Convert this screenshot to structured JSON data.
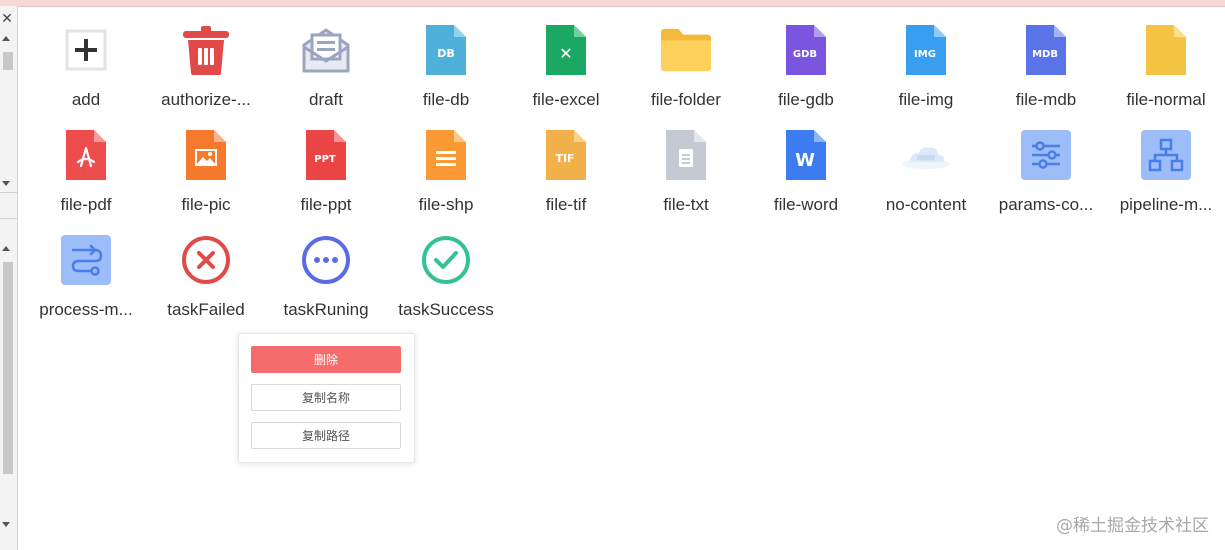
{
  "icons": [
    {
      "label": "add",
      "icon": "add-icon"
    },
    {
      "label": "authorize-...",
      "icon": "trash-icon"
    },
    {
      "label": "draft",
      "icon": "draft-envelope-icon"
    },
    {
      "label": "file-db",
      "icon": "file-db-icon",
      "badge": "DB",
      "color": "#4fb1d9"
    },
    {
      "label": "file-excel",
      "icon": "file-excel-icon",
      "badge": "✕",
      "color": "#1ba862"
    },
    {
      "label": "file-folder",
      "icon": "folder-icon",
      "color": "#fcca4a"
    },
    {
      "label": "file-gdb",
      "icon": "file-gdb-icon",
      "badge": "GDB",
      "color": "#7a55e0"
    },
    {
      "label": "file-img",
      "icon": "file-img-icon",
      "badge": "IMG",
      "color": "#3a9ef0"
    },
    {
      "label": "file-mdb",
      "icon": "file-mdb-icon",
      "badge": "MDB",
      "color": "#5a74e8"
    },
    {
      "label": "file-normal",
      "icon": "file-normal-icon",
      "color": "#f6c443"
    },
    {
      "label": "file-pdf",
      "icon": "file-pdf-icon",
      "color": "#ee4d4d"
    },
    {
      "label": "file-pic",
      "icon": "file-pic-icon",
      "color": "#f57a2e"
    },
    {
      "label": "file-ppt",
      "icon": "file-ppt-icon",
      "badge": "PPT",
      "color": "#ec4546"
    },
    {
      "label": "file-shp",
      "icon": "file-shp-icon",
      "color": "#fb9a35"
    },
    {
      "label": "file-tif",
      "icon": "file-tif-icon",
      "badge": "TIF",
      "color": "#f2b04a"
    },
    {
      "label": "file-txt",
      "icon": "file-txt-icon",
      "color": "#c4c9d3"
    },
    {
      "label": "file-word",
      "icon": "file-word-icon",
      "badge": "W",
      "color": "#3d7cf0"
    },
    {
      "label": "no-content",
      "icon": "no-content-icon"
    },
    {
      "label": "params-co...",
      "icon": "params-sliders-icon",
      "color": "#9dbdf8"
    },
    {
      "label": "pipeline-m...",
      "icon": "pipeline-tree-icon",
      "color": "#9dbdf8"
    },
    {
      "label": "process-m...",
      "icon": "process-flow-icon",
      "color": "#9dbdf8"
    },
    {
      "label": "taskFailed",
      "icon": "task-failed-icon",
      "color": "#e24a4a"
    },
    {
      "label": "taskRuning",
      "icon": "task-running-icon",
      "color": "#5a6be8"
    },
    {
      "label": "taskSuccess",
      "icon": "task-success-icon",
      "color": "#34c38f"
    }
  ],
  "popup": {
    "delete_label": "删除",
    "copy_name_label": "复制名称",
    "copy_path_label": "复制路径"
  },
  "watermark": "@稀土掘金技术社区",
  "colors": {
    "danger": "#f56c6c",
    "text": "#333333"
  }
}
